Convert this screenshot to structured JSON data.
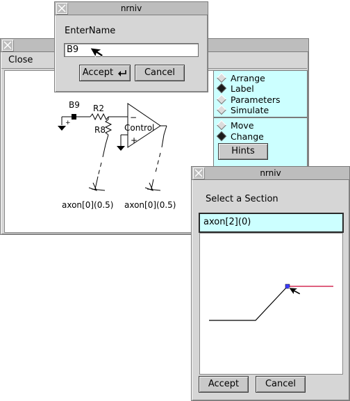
{
  "enter_dialog": {
    "title": "nrniv",
    "prompt": "EnterName",
    "input_value": "B9",
    "accept_label": "Accept",
    "cancel_label": "Cancel"
  },
  "main_window": {
    "menu_close_label": "Close",
    "canvas": {
      "probe_label": "B9",
      "resistor_top_label": "R2",
      "resistor_left_label": "R8",
      "amplifier_label": "Control",
      "minus_sign": "−",
      "plus_sign": "+",
      "small_plus": "+",
      "electrode_left_label": "axon[0](0.5)",
      "electrode_right_label": "axon[0](0.5)"
    },
    "panel": {
      "mode_options": [
        {
          "label": "Arrange",
          "selected": false
        },
        {
          "label": "Label",
          "selected": true
        },
        {
          "label": "Parameters",
          "selected": false
        },
        {
          "label": "Simulate",
          "selected": false
        }
      ],
      "edit_options": [
        {
          "label": "Move",
          "selected": false
        },
        {
          "label": "Change",
          "selected": true
        }
      ],
      "hints_label": "Hints"
    },
    "colors": {
      "panel_bg": "#ccffff"
    }
  },
  "section_dialog": {
    "title": "nrniv",
    "prompt": "Select a Section",
    "selected_section": "axon[2](0)",
    "accept_label": "Accept",
    "cancel_label": "Cancel",
    "colors": {
      "highlight_bg": "#ccffff",
      "marker": "#3b3bff",
      "right_line": "#cc0033"
    }
  }
}
